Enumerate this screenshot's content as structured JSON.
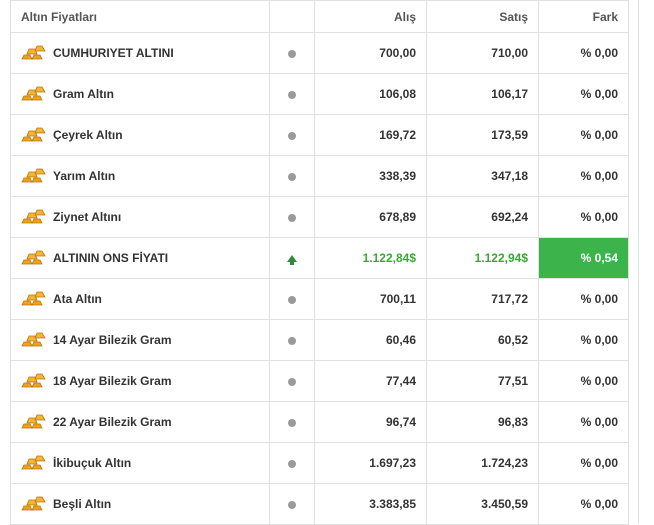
{
  "table": {
    "headers": {
      "name": "Altın Fiyatları",
      "buy": "Alış",
      "sell": "Satış",
      "change": "Fark"
    },
    "rows": [
      {
        "name": "CUMHURIYET ALTINI",
        "trend": "neutral",
        "buy": "700,00",
        "sell": "710,00",
        "change": "% 0,00"
      },
      {
        "name": "Gram Altın",
        "trend": "neutral",
        "buy": "106,08",
        "sell": "106,17",
        "change": "% 0,00"
      },
      {
        "name": "Çeyrek Altın",
        "trend": "neutral",
        "buy": "169,72",
        "sell": "173,59",
        "change": "% 0,00"
      },
      {
        "name": "Yarım Altın",
        "trend": "neutral",
        "buy": "338,39",
        "sell": "347,18",
        "change": "% 0,00"
      },
      {
        "name": "Ziynet Altını",
        "trend": "neutral",
        "buy": "678,89",
        "sell": "692,24",
        "change": "% 0,00"
      },
      {
        "name": "ALTININ ONS FİYATI",
        "trend": "up",
        "buy": "1.122,84$",
        "sell": "1.122,94$",
        "change": "% 0,54"
      },
      {
        "name": "Ata Altın",
        "trend": "neutral",
        "buy": "700,11",
        "sell": "717,72",
        "change": "% 0,00"
      },
      {
        "name": "14 Ayar Bilezik Gram",
        "trend": "neutral",
        "buy": "60,46",
        "sell": "60,52",
        "change": "% 0,00"
      },
      {
        "name": "18 Ayar Bilezik Gram",
        "trend": "neutral",
        "buy": "77,44",
        "sell": "77,51",
        "change": "% 0,00"
      },
      {
        "name": "22 Ayar Bilezik Gram",
        "trend": "neutral",
        "buy": "96,74",
        "sell": "96,83",
        "change": "% 0,00"
      },
      {
        "name": "İkibuçuk Altın",
        "trend": "neutral",
        "buy": "1.697,23",
        "sell": "1.724,23",
        "change": "% 0,00"
      },
      {
        "name": "Beşli Altın",
        "trend": "neutral",
        "buy": "3.383,85",
        "sell": "3.450,59",
        "change": "% 0,00"
      }
    ]
  },
  "icons": {
    "row_icon": "gold-bars-icon",
    "neutral_indicator": "gray-dot-icon",
    "up_indicator": "green-up-arrow-icon"
  },
  "colors": {
    "up_text": "#3aaa35",
    "up_background": "#3cb44b",
    "neutral_dot": "#9a9a9a",
    "gold": "#f0a21b"
  }
}
